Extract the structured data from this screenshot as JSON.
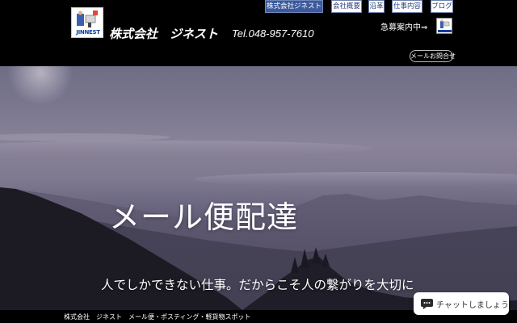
{
  "header": {
    "logo_text": "JINNEST",
    "company_name": "株式会社　ジネスト",
    "phone": "Tel.048-957-7610",
    "nav": [
      {
        "label": "株式会社ジネスト"
      },
      {
        "label": "会社概要"
      },
      {
        "label": "沿革"
      },
      {
        "label": "仕事内容"
      },
      {
        "label": "ブログ"
      }
    ],
    "recruit_label": "急募案内中⇒",
    "contact_label": "メールお問合せ"
  },
  "hero": {
    "title": "メール便配達",
    "subtitle": "人でしかできない仕事。だからこそ人の繋がりを大切に"
  },
  "footer": {
    "text": "株式会社　ジネスト　メール便・ポスティング・軽貨物スポット"
  },
  "chat": {
    "label": "チャットしましょう",
    "icon": "chat-bubble-icon"
  },
  "colors": {
    "nav_active_bg": "#3c5a9c",
    "nav_text": "#2a3d7d",
    "header_bg": "#000000"
  }
}
